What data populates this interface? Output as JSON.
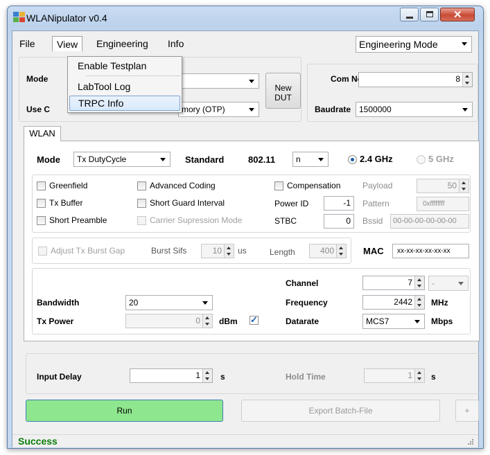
{
  "window": {
    "title": "WLANipulator v0.4"
  },
  "menu": {
    "items": [
      "File",
      "View",
      "Engineering",
      "Info"
    ],
    "dropdown": [
      "Enable Testplan",
      "LabTool Log",
      "TRPC Info"
    ]
  },
  "mode_select": "Engineering Mode",
  "top": {
    "mode_label": "Mode",
    "use_label": "Use C",
    "use_combo_value": "mory (OTP)",
    "new_dut_line1": "New",
    "new_dut_line2": "DUT",
    "com_label": "Com No",
    "com_value": "8",
    "baud_label": "Baudrate",
    "baud_value": "1500000"
  },
  "tab": {
    "label": "WLAN"
  },
  "wlan": {
    "mode_label": "Mode",
    "mode_value": "Tx DutyCycle",
    "standard_label": "Standard",
    "standard_prefix": "802.11",
    "standard_value": "n",
    "band_24": "2.4 GHz",
    "band_5": "5 GHz",
    "band_selected": "2.4 GHz",
    "checks": {
      "greenfield": "Greenfield",
      "tx_buffer": "Tx Buffer",
      "short_preamble": "Short Preamble",
      "adv_coding": "Advanced Coding",
      "short_gi": "Short Guard Interval",
      "carrier": "Carrier Supression Mode",
      "compensation": "Compensation"
    },
    "power_id_label": "Power ID",
    "power_id_value": "-1",
    "stbc_label": "STBC",
    "stbc_value": "0",
    "payload_label": "Payload",
    "payload_value": "50",
    "pattern_label": "Pattern",
    "pattern_value": "0xffffffff",
    "bssid_label": "Bssid",
    "bssid_value": "00-00-00-00-00-00",
    "burst": {
      "adjust_label": "Adjust Tx Burst Gap",
      "sifs_label": "Burst Sifs",
      "sifs_value": "10",
      "sifs_unit": "us",
      "length_label": "Length",
      "length_value": "400"
    },
    "mac_label": "MAC",
    "mac_value": "xx-xx-xx-xx-xx-xx",
    "channel_label": "Channel",
    "channel_value": "7",
    "channel_extra": "-",
    "bandwidth_label": "Bandwidth",
    "bandwidth_value": "20",
    "frequency_label": "Frequency",
    "frequency_value": "2442",
    "frequency_unit": "MHz",
    "txpower_label": "Tx Power",
    "txpower_value": "0",
    "txpower_unit": "dBm",
    "datarate_label": "Datarate",
    "datarate_value": "MCS7",
    "datarate_unit": "Mbps"
  },
  "delay": {
    "input_label": "Input Delay",
    "input_value": "1",
    "input_unit": "s",
    "hold_label": "Hold Time",
    "hold_value": "1",
    "hold_unit": "s"
  },
  "buttons": {
    "run": "Run",
    "export": "Export Batch-File",
    "plus": "+"
  },
  "status": {
    "text": "Success",
    "color": "#0a7d0a"
  }
}
